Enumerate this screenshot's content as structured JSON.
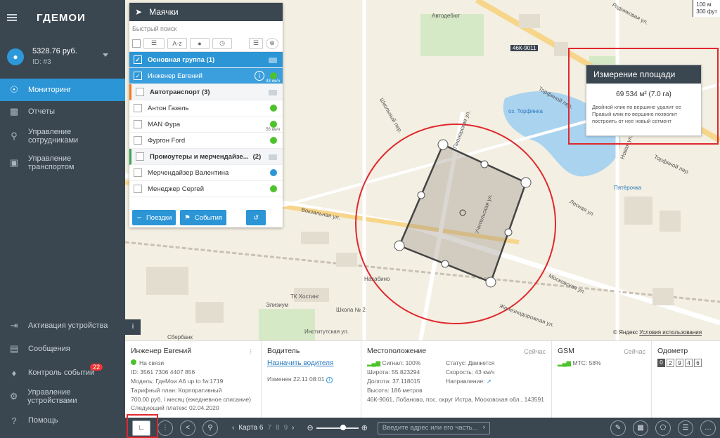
{
  "sidebar": {
    "logo": "ГДЕМОИ",
    "user": {
      "balance": "5328.76 руб.",
      "id": "ID: #3"
    },
    "items": [
      {
        "label": "Мониторинг",
        "icon": "globe-icon"
      },
      {
        "label": "Отчеты",
        "icon": "chart-icon"
      },
      {
        "label": "Управление сотрудниками",
        "icon": "pin-icon"
      },
      {
        "label": "Управление транспортом",
        "icon": "car-icon"
      }
    ],
    "bottom_items": [
      {
        "label": "Активация устройства",
        "icon": "login-icon"
      },
      {
        "label": "Сообщения",
        "icon": "message-icon"
      },
      {
        "label": "Контроль событий",
        "icon": "bell-icon",
        "badge": "22"
      },
      {
        "label": "Управление устройствами",
        "icon": "gear-icon"
      },
      {
        "label": "Помощь",
        "icon": "help-icon"
      }
    ]
  },
  "panel": {
    "title": "Маячки",
    "search_placeholder": "Быстрый поиск",
    "sort_label": "A-z",
    "rows": [
      {
        "label": "Основная группа (1)",
        "type": "group-selected"
      },
      {
        "label": "Инженер Евгений",
        "type": "item-selected",
        "speed": "43 км/ч"
      },
      {
        "label": "Автотранспорт (3)",
        "type": "group"
      },
      {
        "label": "Антон Газель",
        "type": "item"
      },
      {
        "label": "MAN Фура",
        "type": "item",
        "speed": "56 км/ч"
      },
      {
        "label": "Фургон Ford",
        "type": "item"
      },
      {
        "label": "Промоутеры и мерчендайзе...",
        "count": "(2)",
        "type": "group"
      },
      {
        "label": "Мерчендайзер Валентина",
        "type": "item",
        "dot": "#2b95d6"
      },
      {
        "label": "Менеджер Сергей",
        "type": "item"
      }
    ],
    "trips_label": "Поездки",
    "events_label": "События"
  },
  "measure": {
    "title": "Измерение площади",
    "value": "69 534 м² (7.0 га)",
    "hint1": "Двойной клик по вершине удалит ее",
    "hint2": "Правый клик по вершине позволит построить от нее новый сегмент"
  },
  "map": {
    "scale_top": "100 м",
    "scale_bottom": "300 фут",
    "labels": [
      "Автодебют",
      "Родниковая ул.",
      "46К-9011",
      "Торфяной пер.",
      "оз. Торфянка",
      "Новая ул.",
      "Торфяной пер.",
      "Пятёрочка",
      "Лесная ул.",
      "Московская ул.",
      "Железнодорожная ул.",
      "Вокзальная ул.",
      "Пионерская ул.",
      "Учительская ул.",
      "Нахабино",
      "ТК Хостинг",
      "Школа № 2",
      "Элизиум",
      "Институтская ул.",
      "Сбербанк",
      "Школьный пер."
    ],
    "copyright": "© Яндекс",
    "terms": "Условия использования"
  },
  "info": {
    "device": {
      "name": "Инженер Евгений",
      "status": "На связи",
      "id": "ID: 3561 7306 4407 856",
      "model": "Модель: ГдеМои A6 up to fw.1719",
      "tariff": "Тарифный план: Корпоративный",
      "fee": "700.00 руб. / месяц (ежедневное списание)",
      "next": "Следующий платеж: 02.04.2020"
    },
    "driver": {
      "title": "Водитель",
      "assign": "Назначить водителя",
      "changed": "Изменен 22.11 08:01"
    },
    "location": {
      "title": "Местоположение",
      "sync": "Сейчас",
      "signal": "Сигнал: 100%",
      "lat": "Широта: 55.823294",
      "lon": "Долгота: 37.118015",
      "alt": "Высота: 186 метров",
      "status": "Статус: Движется",
      "speed": "Скорость: 43 км/ч",
      "direction": "Направление:",
      "address": "46К-9061, Лобаново, пос. округ Истра, Московская обл., 143591"
    },
    "gsm": {
      "title": "GSM",
      "sync": "Сейчас",
      "operator": "МТС: 58%"
    },
    "odometer": {
      "title": "Одометр",
      "digits": [
        "0",
        "2",
        "9",
        "4",
        "6"
      ]
    }
  },
  "bottom": {
    "map_label": "Карта 6",
    "pages": [
      "7",
      "8",
      "9"
    ],
    "address_placeholder": "Введите адрес или его часть..."
  },
  "colors": {
    "sidebar": "#3a4650",
    "accent": "#2b95d6",
    "red": "#e0282e",
    "green": "#4cc32c"
  }
}
